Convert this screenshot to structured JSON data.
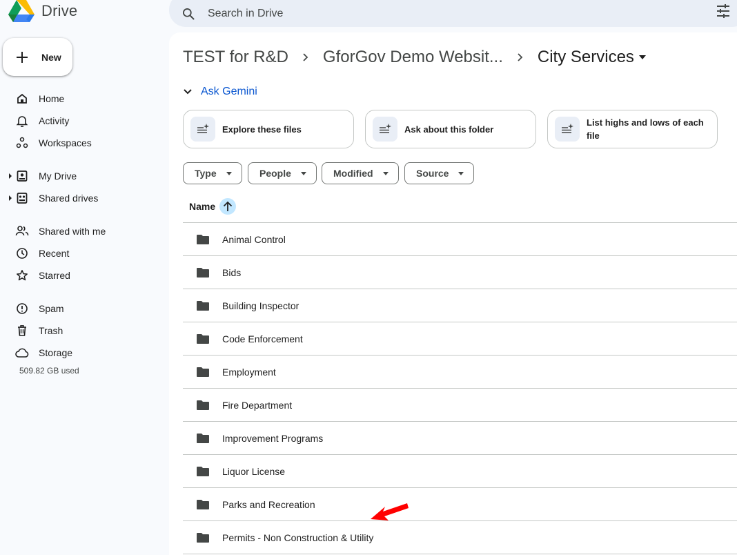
{
  "app": {
    "name": "Drive"
  },
  "search": {
    "placeholder": "Search in Drive"
  },
  "sidebar": {
    "new_label": "New",
    "items": [
      {
        "label": "Home",
        "icon": "home-icon"
      },
      {
        "label": "Activity",
        "icon": "bell-icon"
      },
      {
        "label": "Workspaces",
        "icon": "workspaces-icon"
      },
      {
        "label": "My Drive",
        "icon": "my-drive-icon"
      },
      {
        "label": "Shared drives",
        "icon": "shared-drives-icon"
      },
      {
        "label": "Shared with me",
        "icon": "people-icon"
      },
      {
        "label": "Recent",
        "icon": "clock-icon"
      },
      {
        "label": "Starred",
        "icon": "star-icon"
      },
      {
        "label": "Spam",
        "icon": "spam-icon"
      },
      {
        "label": "Trash",
        "icon": "trash-icon"
      },
      {
        "label": "Storage",
        "icon": "cloud-icon"
      }
    ],
    "storage_used": "509.82 GB used"
  },
  "breadcrumb": {
    "items": [
      "TEST for R&D",
      "GforGov Demo Websit...",
      "City Services"
    ]
  },
  "gemini": {
    "label": "Ask Gemini",
    "chips": [
      "Explore these files",
      "Ask about this folder",
      "List highs and lows of each file"
    ]
  },
  "filters": [
    "Type",
    "People",
    "Modified",
    "Source"
  ],
  "list": {
    "header": "Name",
    "folders": [
      "Animal Control",
      "Bids",
      "Building Inspector",
      "Code Enforcement",
      "Employment",
      "Fire Department",
      "Improvement Programs",
      "Liquor License",
      "Parks and Recreation",
      "Permits - Non Construction & Utility"
    ]
  },
  "colors": {
    "accent": "#0b57d0",
    "sort_highlight": "#c2e7ff",
    "annotation_arrow": "#ff0000"
  }
}
